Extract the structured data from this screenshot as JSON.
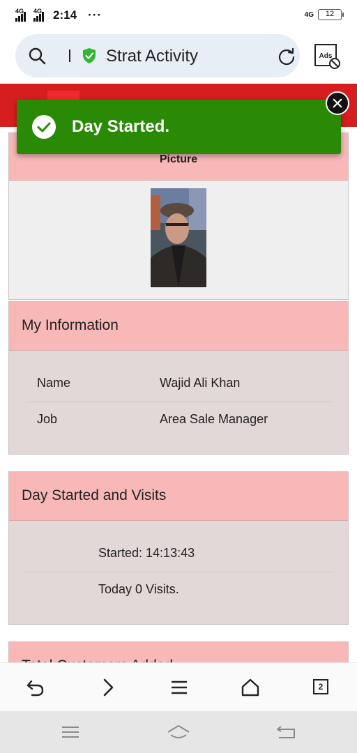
{
  "status_bar": {
    "network_1": "4G",
    "network_2": "4G",
    "time": "2:14",
    "more": "···",
    "right_network": "4G",
    "battery": "12"
  },
  "browser": {
    "page_title": "Strat Activity",
    "ads_label": "Ads",
    "tabs_count": "2"
  },
  "toast": {
    "message": "Day Started."
  },
  "picture_card": {
    "header": "Picture"
  },
  "info_card": {
    "title": "My Information",
    "rows": [
      {
        "label": "Name",
        "value": "Wajid Ali Khan"
      },
      {
        "label": "Job",
        "value": "Area Sale Manager"
      }
    ]
  },
  "day_card": {
    "title": "Day Started and Visits",
    "started": "Started: 14:13:43",
    "visits": "Today 0 Visits."
  },
  "total_card": {
    "title": "Total Customers Added"
  },
  "colors": {
    "header_red": "#d71e1e",
    "card_header_pink": "#f9b8b8",
    "toast_green": "#2a8a05"
  }
}
